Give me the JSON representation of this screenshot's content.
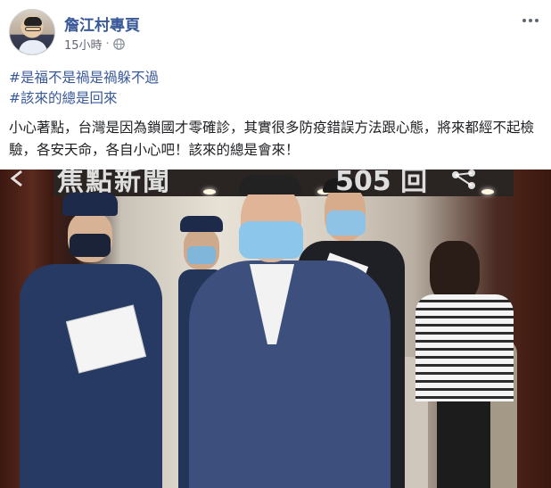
{
  "post": {
    "page_name": "詹江村專頁",
    "timestamp": "15小時",
    "separator": "·",
    "audience_icon": "globe-icon",
    "menu_icon": "more-options-icon",
    "hashtags": [
      "#是福不是禍是禍躲不過",
      "#該來的總是回來"
    ],
    "text": "小心著點，台灣是因為鎖國才零確診，其實很多防疫錯誤方法跟心態，將來都經不起檢驗，各安天命，各自小心吧！該來的總是會來！"
  },
  "photo": {
    "overlay_title": "焦點新聞",
    "overlay_count": "505 回",
    "back_icon": "arrow-left-icon",
    "share_icon": "share-icon"
  },
  "colors": {
    "link": "#385898",
    "text": "#1c1e21",
    "meta": "#616770"
  }
}
